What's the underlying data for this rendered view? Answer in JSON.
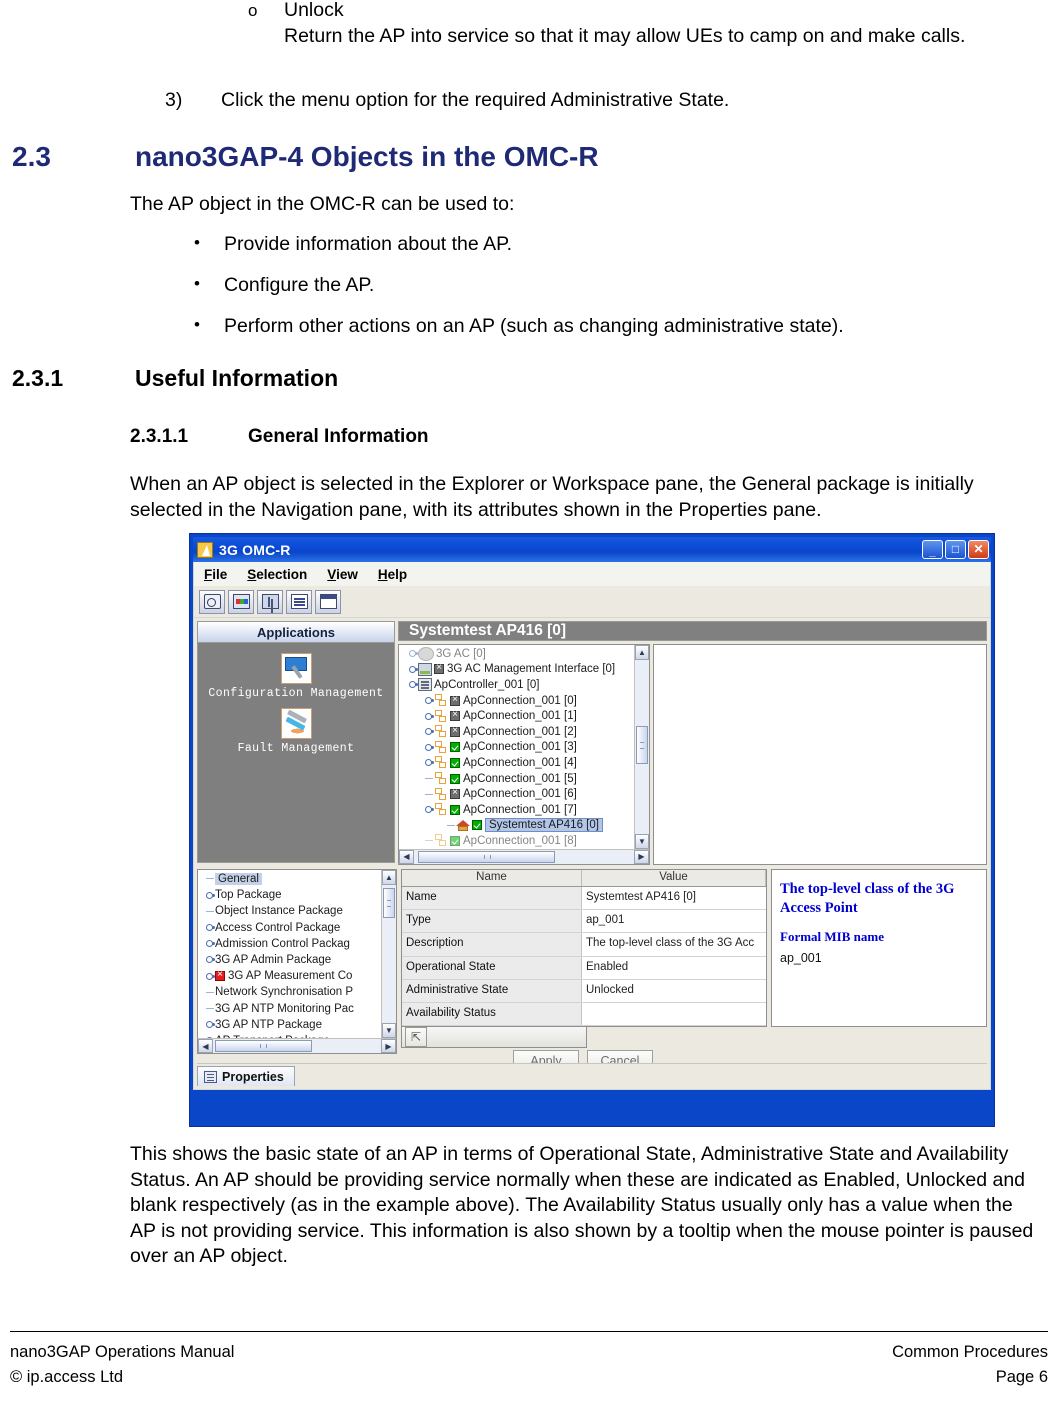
{
  "doc": {
    "sub_bullet": {
      "marker": "o",
      "title": "Unlock",
      "body": "Return the AP into service so that it may allow UEs to camp on and make calls."
    },
    "numbered_item": {
      "number": "3)",
      "text": "Click the menu option for the required Administrative State."
    },
    "h1": {
      "number": "2.3",
      "text": "nano3GAP-4 Objects in the OMC-R",
      "color": "#1f2a77"
    },
    "intro": "The AP object in the OMC-R can be used to:",
    "bullets": [
      "Provide information about the AP.",
      "Configure the AP.",
      "Perform other actions on an AP (such as changing administrative state)."
    ],
    "h2": {
      "number": "2.3.1",
      "text": "Useful Information"
    },
    "h3": {
      "number": "2.3.1.1",
      "text": "General Information"
    },
    "explain": "When an AP object is selected in the Explorer or Workspace pane, the General package is initially selected in the Navigation pane, with its attributes shown in the Properties pane.",
    "closing": "This shows the basic state of an AP in terms of Operational State, Administrative State and Availability Status.  An AP should be providing service normally when these are indicated as Enabled, Unlocked and blank respectively (as in the example above). The Availability Status usually only has a value when the AP is not providing service. This information is also shown by a tooltip when the mouse pointer is paused over an AP object.",
    "footer": {
      "left_top": "nano3GAP Operations Manual",
      "left_bottom": "© ip.access Ltd",
      "right_top": "Common Procedures",
      "right_bottom": "Page 6"
    }
  },
  "app": {
    "title": "3G OMC-R",
    "window_buttons": {
      "minimize": "_",
      "maximize": "□",
      "close": "✕"
    },
    "menu": [
      {
        "accel": "F",
        "rest": "ile"
      },
      {
        "accel": "S",
        "rest": "election"
      },
      {
        "accel": "V",
        "rest": "iew"
      },
      {
        "accel": "H",
        "rest": "elp"
      }
    ],
    "toolbar_icons": [
      "explorer-icon",
      "colors-icon",
      "tree-icon",
      "list-icon",
      "window-icon"
    ],
    "applications": {
      "header": "Applications",
      "items": [
        {
          "label": "Configuration Management",
          "icon": "configuration-management-icon"
        },
        {
          "label": "Fault Management",
          "icon": "fault-management-icon"
        }
      ]
    },
    "workspace": {
      "header": "Systemtest AP416 [0]",
      "tree": [
        {
          "label": "3G AC [0]",
          "indent": 8,
          "handle": "knob",
          "icon": "ac",
          "badge": null,
          "partial": true
        },
        {
          "label": "3G AC Management Interface [0]",
          "indent": 8,
          "handle": "knob",
          "icon": "mgmt",
          "badge": "x",
          "partial": false
        },
        {
          "label": "ApController_001 [0]",
          "indent": 8,
          "handle": "knob",
          "icon": "ctrl",
          "badge": null,
          "partial": false
        },
        {
          "label": "ApConnection_001 [0]",
          "indent": 24,
          "handle": "knob",
          "icon": "conn",
          "badge": "x",
          "partial": false
        },
        {
          "label": "ApConnection_001 [1]",
          "indent": 24,
          "handle": "knob",
          "icon": "conn",
          "badge": "x",
          "partial": false
        },
        {
          "label": "ApConnection_001 [2]",
          "indent": 24,
          "handle": "knob",
          "icon": "conn",
          "badge": "x",
          "partial": false
        },
        {
          "label": "ApConnection_001 [3]",
          "indent": 24,
          "handle": "knob",
          "icon": "conn",
          "badge": "ok",
          "partial": false
        },
        {
          "label": "ApConnection_001 [4]",
          "indent": 24,
          "handle": "knob",
          "icon": "conn",
          "badge": "ok",
          "partial": false
        },
        {
          "label": "ApConnection_001 [5]",
          "indent": 24,
          "handle": "dash",
          "icon": "conn",
          "badge": "ok",
          "partial": false
        },
        {
          "label": "ApConnection_001 [6]",
          "indent": 24,
          "handle": "dash",
          "icon": "conn",
          "badge": "x",
          "partial": false
        },
        {
          "label": "ApConnection_001 [7]",
          "indent": 24,
          "handle": "knob",
          "icon": "conn",
          "badge": "ok",
          "partial": false
        },
        {
          "label": "Systemtest AP416 [0]",
          "indent": 46,
          "handle": "dash",
          "icon": "home",
          "badge": "ok",
          "partial": false,
          "selected": true
        },
        {
          "label": "ApConnection_001 [8]",
          "indent": 24,
          "handle": "dash",
          "icon": "conn",
          "badge": "ok",
          "partial": true
        }
      ]
    },
    "navigation": {
      "items": [
        {
          "label": "General",
          "handle": "dash",
          "badge": null,
          "selected": true
        },
        {
          "label": "Top Package",
          "handle": "knob",
          "badge": null
        },
        {
          "label": "Object Instance Package",
          "handle": "dash",
          "badge": null
        },
        {
          "label": "Access Control Package",
          "handle": "knob",
          "badge": null
        },
        {
          "label": "Admission Control Packag",
          "handle": "knob",
          "badge": null
        },
        {
          "label": "3G AP Admin Package",
          "handle": "knob",
          "badge": null
        },
        {
          "label": "3G AP Measurement Co",
          "handle": "knob",
          "badge": "err"
        },
        {
          "label": "Network Synchronisation P",
          "handle": "dash",
          "badge": null
        },
        {
          "label": "3G AP NTP Monitoring Pac",
          "handle": "dash",
          "badge": null
        },
        {
          "label": "3G AP NTP Package",
          "handle": "knob",
          "badge": null
        },
        {
          "label": "AP Transport Package",
          "handle": "knob",
          "badge": null
        }
      ]
    },
    "properties": {
      "columns": [
        "Name",
        "Value"
      ],
      "rows": [
        {
          "name": "Name",
          "value": "Systemtest AP416 [0]"
        },
        {
          "name": "Type",
          "value": "ap_001"
        },
        {
          "name": "Description",
          "value": "The top-level class of the 3G Acc"
        },
        {
          "name": "Operational State",
          "value": "Enabled"
        },
        {
          "name": "Administrative State",
          "value": "Unlocked"
        },
        {
          "name": "Availability Status",
          "value": ""
        }
      ],
      "up_button_icon": "up-arrow-icon",
      "apply_label": "Apply",
      "cancel_label": "Cancel"
    },
    "tooltip": {
      "heading": "The top-level class of the 3G Access Point",
      "subheading": "Formal MIB name",
      "value": "ap_001",
      "color": "#0000d0"
    },
    "tab": {
      "label": "Properties",
      "icon": "properties-icon"
    }
  }
}
